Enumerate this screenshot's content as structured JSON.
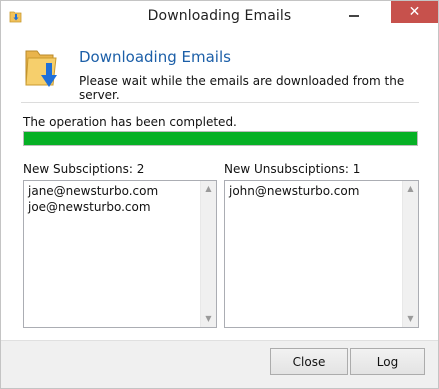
{
  "window": {
    "title": "Downloading Emails",
    "close_glyph": "✕",
    "app_icon": "folder-download-icon"
  },
  "header": {
    "title": "Downloading Emails",
    "subtitle": "Please wait while the emails are downloaded from the server.",
    "icon": "folder-download-icon"
  },
  "status": {
    "text": "The operation has been completed.",
    "progress_percent": 100,
    "progress_color": "#06b025"
  },
  "subscriptions": {
    "label": "New Subsciptions: 2",
    "items": [
      "jane@newsturbo.com",
      "joe@newsturbo.com"
    ]
  },
  "unsubscriptions": {
    "label": "New Unsubsciptions: 1",
    "items": [
      "john@newsturbo.com"
    ]
  },
  "buttons": {
    "close": "Close",
    "log": "Log"
  },
  "colors": {
    "accent": "#1c5fa8",
    "close_button": "#c7514c"
  },
  "icons": {
    "scroll_up": "▲",
    "scroll_down": "▼"
  }
}
